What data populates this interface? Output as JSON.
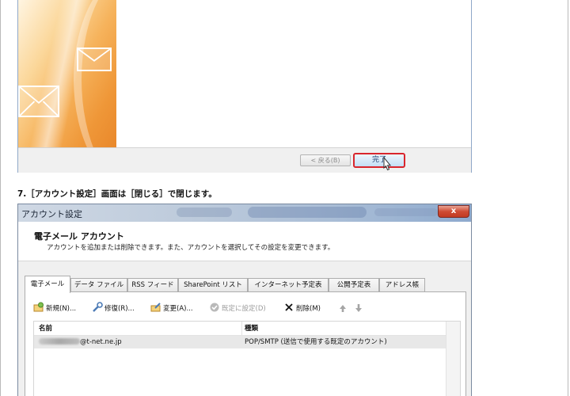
{
  "wizard": {
    "back_button": "< 戻る(B)",
    "finish_button": "完了"
  },
  "step_caption": "7.［アカウント設定］画面は［閉じる］で閉じます。",
  "dialog": {
    "title": "アカウント設定",
    "close_label": "x",
    "header_title": "電子メール アカウント",
    "header_desc": "アカウントを追加または削除できます。また、アカウントを選択してその設定を変更できます。",
    "tabs": [
      {
        "label": "電子メール"
      },
      {
        "label": "データ ファイル"
      },
      {
        "label": "RSS フィード"
      },
      {
        "label": "SharePoint リスト"
      },
      {
        "label": "インターネット予定表"
      },
      {
        "label": "公開予定表"
      },
      {
        "label": "アドレス帳"
      }
    ],
    "toolbar": {
      "new": "新規(N)...",
      "repair": "修復(R)...",
      "change": "変更(A)...",
      "set_default": "既定に設定(D)",
      "delete": "削除(M)"
    },
    "columns": {
      "name": "名前",
      "type": "種類"
    },
    "rows": [
      {
        "name_suffix": "@t-net.ne.jp",
        "type": "POP/SMTP (送信で使用する既定のアカウント)"
      }
    ]
  },
  "colors": {
    "highlight_border": "#d9262d",
    "titlebar": "#a9bdd6",
    "close_button": "#cf4b33"
  }
}
